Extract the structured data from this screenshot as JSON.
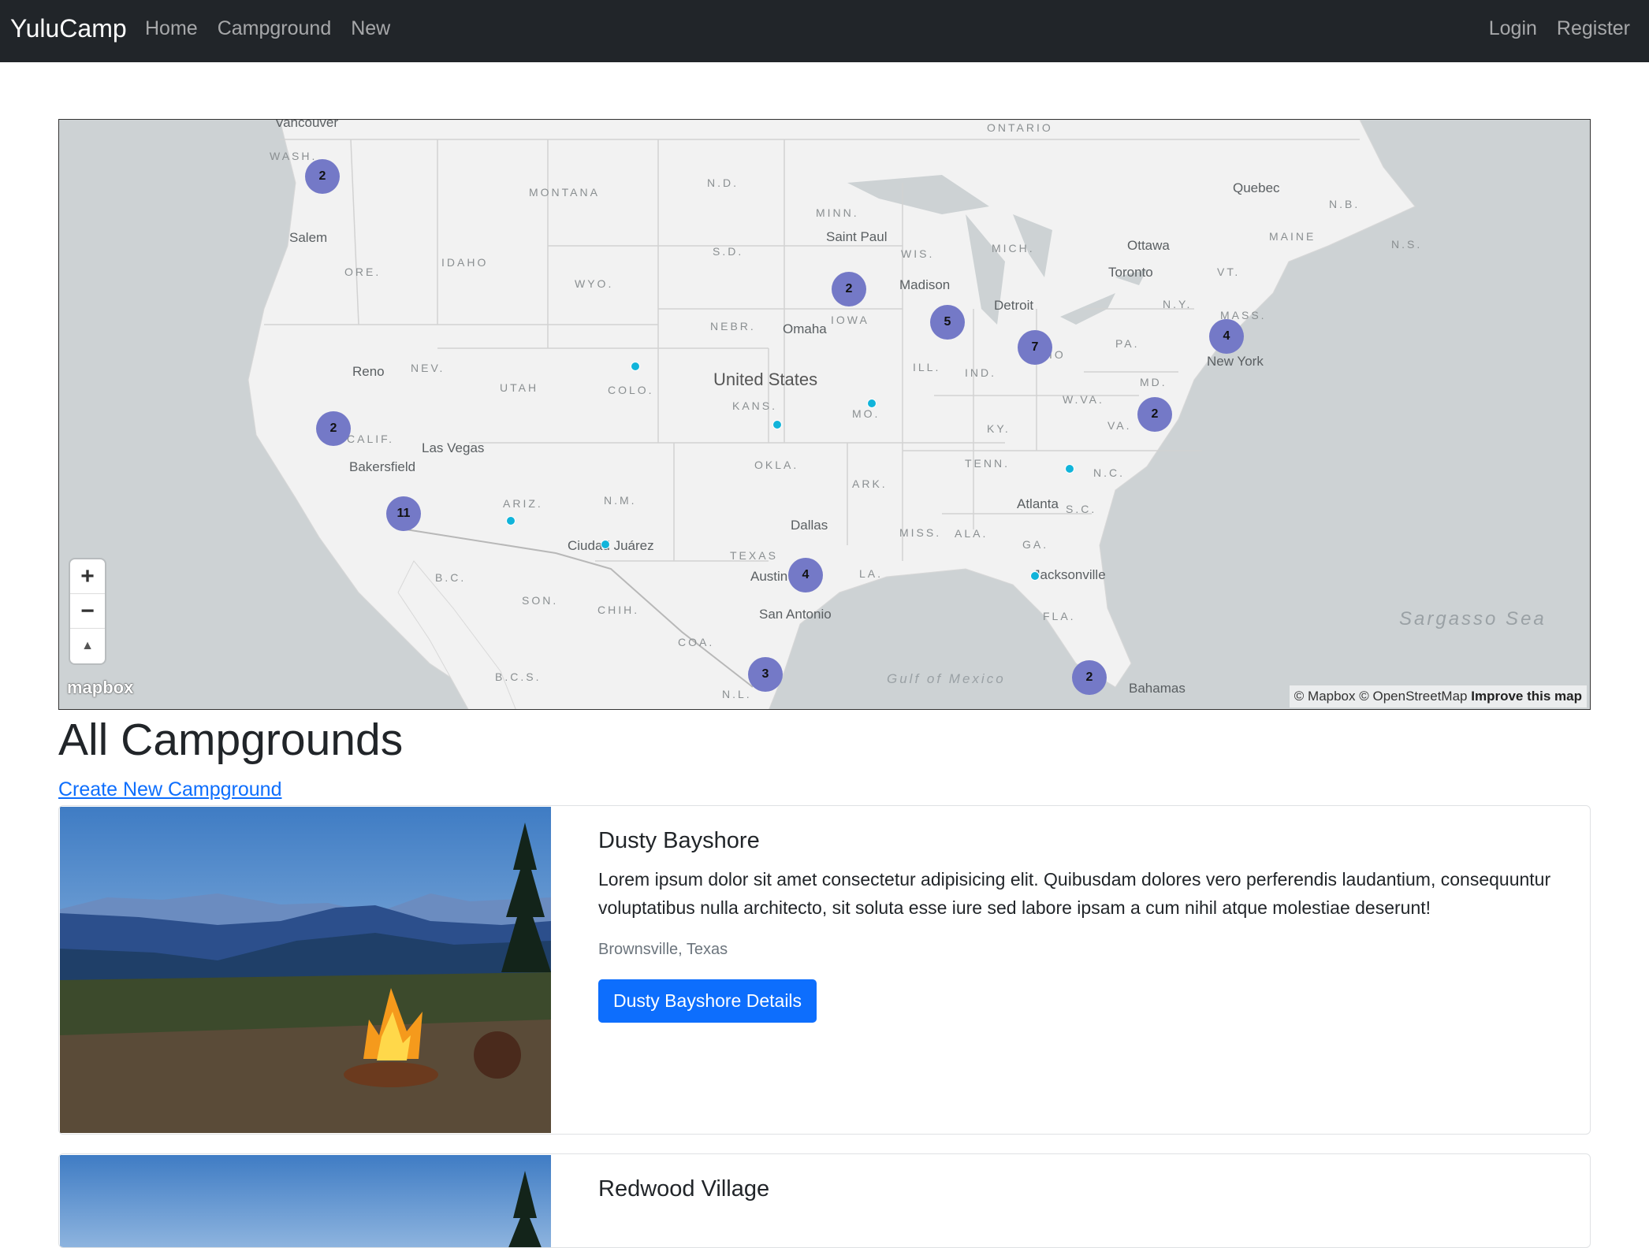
{
  "navbar": {
    "brand": "YuluCamp",
    "links": [
      "Home",
      "Campground",
      "New"
    ],
    "right_links": [
      "Login",
      "Register"
    ]
  },
  "map": {
    "region_labels": [
      "WASH.",
      "MONTANA",
      "N.D.",
      "MINN.",
      "ONTARIO",
      "Quebec",
      "N.B.",
      "MAINE",
      "N.S.",
      "S.D.",
      "WIS.",
      "MICH.",
      "ORE.",
      "IDAHO",
      "WYO.",
      "IOWA",
      "NEBR.",
      "N.Y.",
      "VT.",
      "MASS.",
      "PA.",
      "NEV.",
      "UTAH",
      "COLO.",
      "KANS.",
      "MO.",
      "ILL.",
      "IND.",
      "OHIO",
      "W.VA.",
      "VA.",
      "KY.",
      "MD.",
      "CALIF.",
      "ARIZ.",
      "N.M.",
      "OKLA.",
      "ARK.",
      "TENN.",
      "N.C.",
      "S.C.",
      "TEXAS",
      "MISS.",
      "ALA.",
      "GA.",
      "LA.",
      "FLA.",
      "SON.",
      "CHIH.",
      "COA.",
      "B.C.",
      "B.C.S.",
      "N.L."
    ],
    "cities": [
      "Vancouver",
      "Salem",
      "Saint Paul",
      "Madison",
      "Ottawa",
      "Toronto",
      "Detroit",
      "Omaha",
      "New York",
      "Reno",
      "Las Vegas",
      "Bakersfield",
      "Dallas",
      "Ciudad Juárez",
      "Austin",
      "San Antonio",
      "Atlanta",
      "Jacksonville",
      "Bahamas"
    ],
    "country": "United States",
    "water": [
      "Gulf of Mexico",
      "Sargasso Sea"
    ],
    "clusters": [
      "2",
      "2",
      "5",
      "7",
      "4",
      "2",
      "2",
      "11",
      "4",
      "3",
      "2"
    ],
    "zoom_in": "+",
    "zoom_out": "−",
    "compass": "▲",
    "logo": "mapbox",
    "attribution": "© Mapbox © OpenStreetMap",
    "improve": "Improve this map"
  },
  "page": {
    "title": "All Campgrounds",
    "create_link": "Create New Campground"
  },
  "campgrounds": [
    {
      "title": "Dusty Bayshore",
      "description": "Lorem ipsum dolor sit amet consectetur adipisicing elit. Quibusdam dolores vero perferendis laudantium, consequuntur voluptatibus nulla architecto, sit soluta esse iure sed labore ipsam a cum nihil atque molestiae deserunt!",
      "location": "Brownsville, Texas",
      "button": "Dusty Bayshore Details"
    },
    {
      "title": "Redwood Village"
    }
  ],
  "colors": {
    "navbar_bg": "#212529",
    "primary": "#0d6efd",
    "cluster": "#7479c7",
    "point": "#11b4da"
  }
}
